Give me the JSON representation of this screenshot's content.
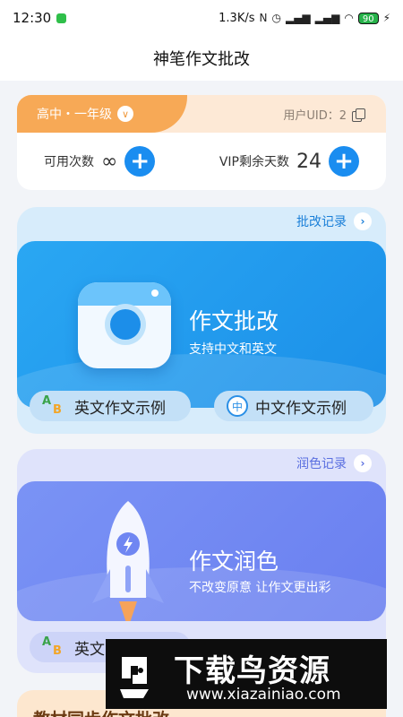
{
  "status_bar": {
    "time": "12:30",
    "speed": "1.3K/s",
    "battery": "90"
  },
  "header": {
    "title": "神笔作文批改"
  },
  "user_card": {
    "grade": "高中・一年级",
    "uid": "用户UID：2",
    "available_label": "可用次数",
    "available_value": "∞",
    "vip_label": "VIP剩余天数",
    "vip_value": "24"
  },
  "essay_correction": {
    "record_link": "批改记录",
    "title": "作文批改",
    "subtitle": "支持中文和英文",
    "english_example": "英文作文示例",
    "chinese_example": "中文作文示例",
    "chinese_icon_char": "中"
  },
  "essay_polish": {
    "record_link": "润色记录",
    "title": "作文润色",
    "subtitle": "不改变原意 让作文更出彩",
    "english_example": "英文"
  },
  "textbook_sync": {
    "title": "教材同步作文批改"
  },
  "watermark": {
    "brand": "下载鸟资源",
    "url": "www.xiazainiao.com"
  },
  "icons": {
    "ab": "AB",
    "chevron": "∨",
    "arrow": "›",
    "plus": "+"
  }
}
